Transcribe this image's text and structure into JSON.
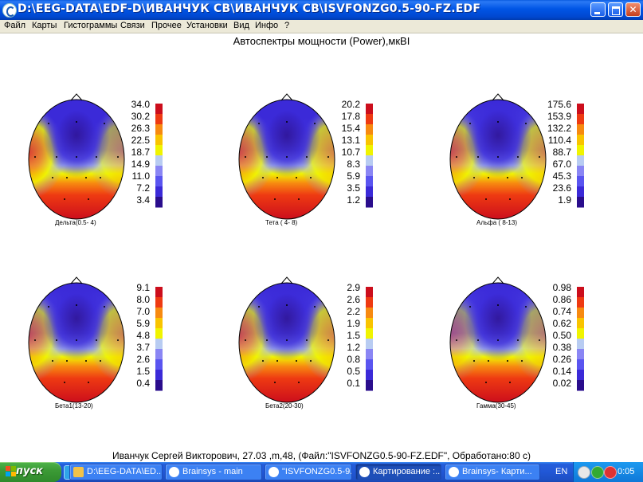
{
  "window": {
    "title": "D:\\EEG-DATA\\EDF-D\\ИВАНЧУК СВ\\ИВАНЧУК СВ\\ISVFONZG0.5-90-FZ.EDF"
  },
  "menu": [
    "Файл",
    "Карты",
    "Гистограммы",
    "Связи",
    "Прочее",
    "Установки",
    "Вид",
    "Инфо",
    "?"
  ],
  "title": "Автоспектры мощности (Power),мкВI",
  "footer": "Иванчук Сергей Викторович, 27.03 ,m,48, (Файл:\"ISVFONZG0.5-90-FZ.EDF\", Обработано:80  с)",
  "colors": {
    "scale": [
      "#2a0d8c",
      "#3b2ad8",
      "#5a55f0",
      "#8a86f4",
      "#b8ccf2",
      "#f0f400",
      "#f9c400",
      "#f78a10",
      "#ee3a12",
      "#cc0e1c"
    ]
  },
  "maps": [
    {
      "label": "Дельта(0.5- 4)",
      "ticks": [
        "34.0",
        "30.2",
        "26.3",
        "22.5",
        "18.7",
        "14.9",
        "11.0",
        "7.2",
        "3.4"
      ]
    },
    {
      "label": "Тета ( 4- 8)",
      "ticks": [
        "20.2",
        "17.8",
        "15.4",
        "13.1",
        "10.7",
        "8.3",
        "5.9",
        "3.5",
        "1.2"
      ]
    },
    {
      "label": "Альфа ( 8-13)",
      "ticks": [
        "175.6",
        "153.9",
        "132.2",
        "110.4",
        "88.7",
        "67.0",
        "45.3",
        "23.6",
        "1.9"
      ]
    },
    {
      "label": "Бета1(13-20)",
      "ticks": [
        "9.1",
        "8.0",
        "7.0",
        "5.9",
        "4.8",
        "3.7",
        "2.6",
        "1.5",
        "0.4"
      ]
    },
    {
      "label": "Бета2(20-30)",
      "ticks": [
        "2.9",
        "2.6",
        "2.2",
        "1.9",
        "1.5",
        "1.2",
        "0.8",
        "0.5",
        "0.1"
      ]
    },
    {
      "label": "Гамма(30-45)",
      "ticks": [
        "0.98",
        "0.86",
        "0.74",
        "0.62",
        "0.50",
        "0.38",
        "0.26",
        "0.14",
        "0.02"
      ]
    }
  ],
  "taskbar": {
    "start": "пуск",
    "buttons": [
      "D:\\EEG-DATA\\ED...",
      "Brainsys - main",
      "\"ISVFONZG0.5-9...",
      "Картирование :...",
      "Brainsys- Карти..."
    ],
    "lang": "EN",
    "clock": "0:05"
  }
}
